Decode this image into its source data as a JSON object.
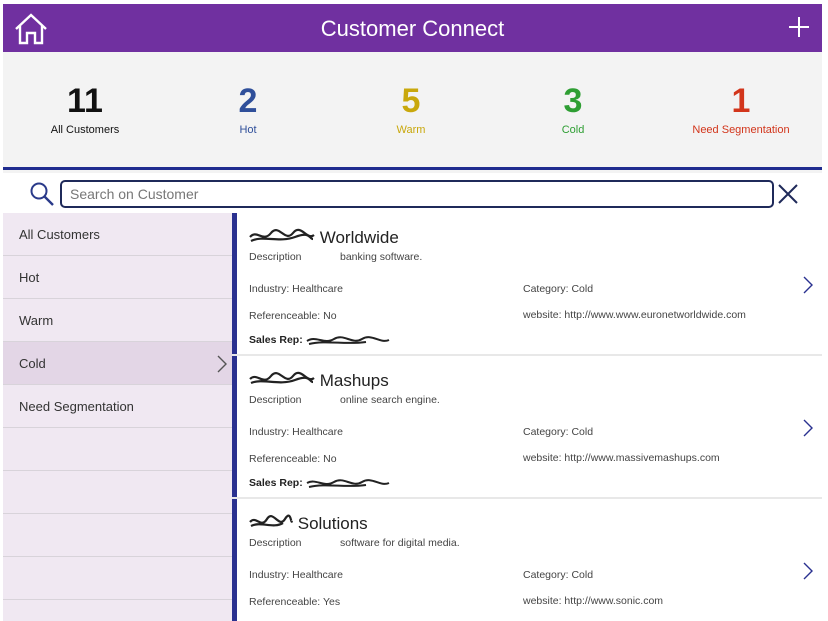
{
  "header": {
    "title": "Customer Connect",
    "home_icon": "home-icon",
    "add_icon": "plus-icon",
    "background": "#7030a0"
  },
  "stats": [
    {
      "count": "11",
      "label": "All Customers",
      "color": "#111111"
    },
    {
      "count": "2",
      "label": "Hot",
      "color": "#2f4f9a"
    },
    {
      "count": "5",
      "label": "Warm",
      "color": "#c9a80c"
    },
    {
      "count": "3",
      "label": "Cold",
      "color": "#2e9e33"
    },
    {
      "count": "1",
      "label": "Need Segmentation",
      "color": "#d2351b"
    }
  ],
  "search": {
    "placeholder": "Search on Customer",
    "value": "",
    "search_icon": "search-icon",
    "clear_icon": "close-icon"
  },
  "nav": {
    "items": [
      {
        "label": "All Customers",
        "selected": false
      },
      {
        "label": "Hot",
        "selected": false
      },
      {
        "label": "Warm",
        "selected": false
      },
      {
        "label": "Cold",
        "selected": true
      },
      {
        "label": "Need Segmentation",
        "selected": false
      }
    ]
  },
  "customers": [
    {
      "name_visible": "Worldwide",
      "description_label": "Description",
      "description": "banking software.",
      "industry": "Industry: Healthcare",
      "referenceable": "Referenceable: No",
      "category": "Category: Cold",
      "website": "website: http://www.www.euronetworldwide.com",
      "sales_rep_label": "Sales Rep:"
    },
    {
      "name_visible": "Mashups",
      "description_label": "Description",
      "description": "online search engine.",
      "industry": "Industry: Healthcare",
      "referenceable": "Referenceable: No",
      "category": "Category: Cold",
      "website": "website: http://www.massivemashups.com",
      "sales_rep_label": "Sales Rep:"
    },
    {
      "name_visible": "Solutions",
      "description_label": "Description",
      "description": "software for digital media.",
      "industry": "Industry: Healthcare",
      "referenceable": "Referenceable: Yes",
      "category": "Category: Cold",
      "website": "website: http://www.sonic.com",
      "sales_rep_label": ""
    }
  ],
  "colors": {
    "accent": "#7030a0",
    "divider": "#1f2c8f",
    "card_border": "#2a3190",
    "nav_background": "#f0e8f2",
    "nav_selected": "#e3d6e6"
  }
}
